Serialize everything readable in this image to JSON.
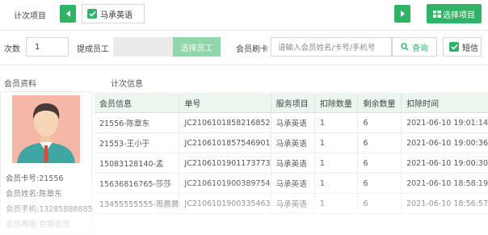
{
  "header": {
    "project_label": "计次项目",
    "current_project": "马承英语",
    "choose_project_button": "选择项目"
  },
  "form": {
    "count_label": "次数",
    "count_value": "1",
    "staff_label": "提成员工",
    "choose_staff_button": "选择员工",
    "card_label": "会员刷卡",
    "card_placeholder": "请输入会员姓名/卡号/手机号",
    "query_button": "查询",
    "sms_label": "短信"
  },
  "member": {
    "section_title": "会员资料",
    "card_no": "会员卡号:21556",
    "name": "会员姓名:陈章东",
    "phone": "会员手机:13285888885",
    "level": "会员等级:白银会员"
  },
  "records": {
    "section_title": "计次信息",
    "columns": [
      "会员信息",
      "单号",
      "服务项目",
      "扣除数量",
      "剩余数量",
      "扣除时间"
    ],
    "rows": [
      [
        "21556-陈章东",
        "JC2106101858216852",
        "马承英语",
        "1",
        "6",
        "2021-06-10  19:01:14"
      ],
      [
        "21553-王小于",
        "JC2106101857546901",
        "马承英语",
        "1",
        "6",
        "2021-06-10  19:00:36"
      ],
      [
        "15083128140-孟",
        "JC2106101901173773",
        "马承英语",
        "1",
        "6",
        "2021-06-10  19:00:30"
      ],
      [
        "15636816765-莎莎",
        "JC2106101900389754",
        "马承英语",
        "1",
        "6",
        "2021-06-10  18:58:19"
      ],
      [
        "13455555555-周晨晨",
        "JC2106101900335463",
        "马承英语",
        "1",
        "6",
        "2021-06-10  18:56:57"
      ]
    ]
  },
  "colors": {
    "accent": "#2fb467",
    "table_header": "#eaf6ee",
    "avatar_bg": "#f5b8a6"
  }
}
